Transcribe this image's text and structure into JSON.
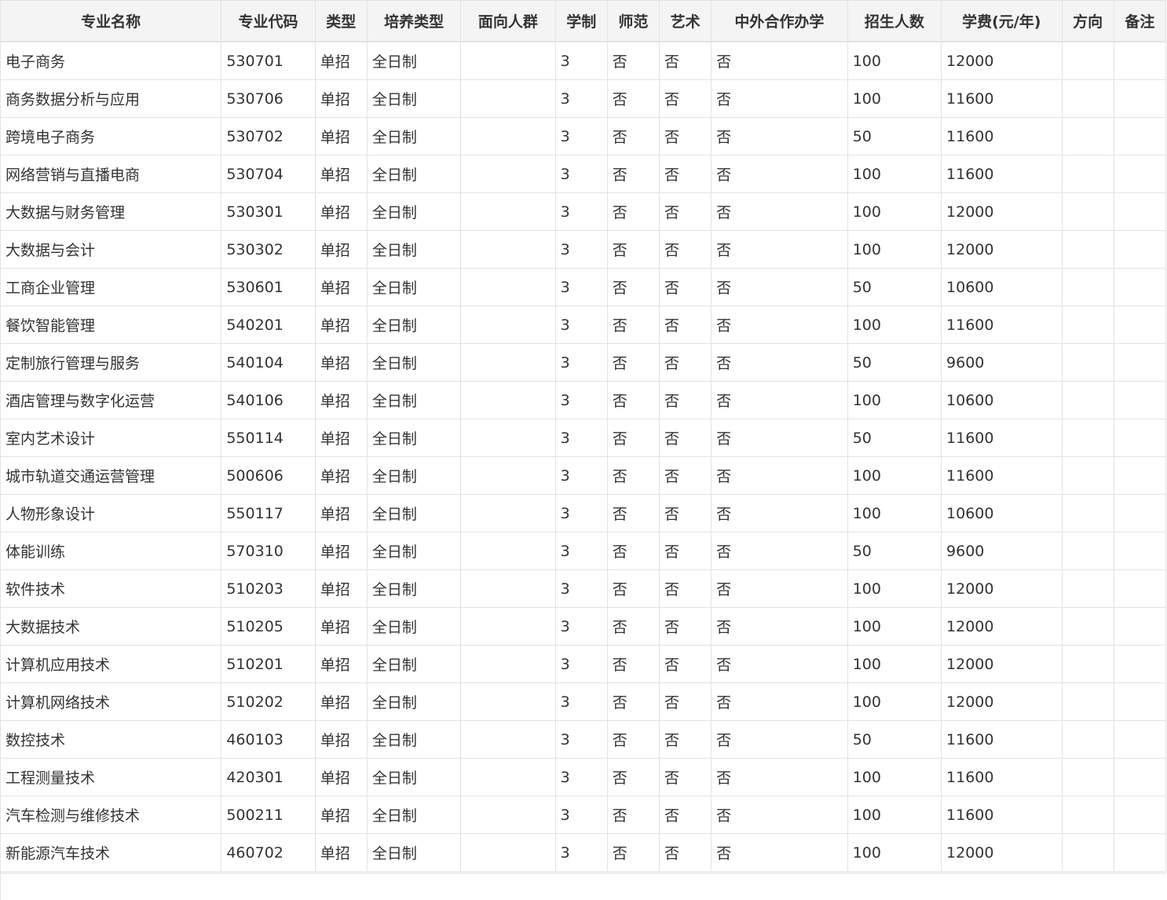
{
  "table": {
    "columns": [
      "专业名称",
      "专业代码",
      "类型",
      "培养类型",
      "面向人群",
      "学制",
      "师范",
      "艺术",
      "中外合作办学",
      "招生人数",
      "学费(元/年)",
      "方向",
      "备注"
    ],
    "rows": [
      [
        "电子商务",
        "530701",
        "单招",
        "全日制",
        "",
        "3",
        "否",
        "否",
        "否",
        "100",
        "12000",
        "",
        ""
      ],
      [
        "商务数据分析与应用",
        "530706",
        "单招",
        "全日制",
        "",
        "3",
        "否",
        "否",
        "否",
        "100",
        "11600",
        "",
        ""
      ],
      [
        "跨境电子商务",
        "530702",
        "单招",
        "全日制",
        "",
        "3",
        "否",
        "否",
        "否",
        "50",
        "11600",
        "",
        ""
      ],
      [
        "网络营销与直播电商",
        "530704",
        "单招",
        "全日制",
        "",
        "3",
        "否",
        "否",
        "否",
        "100",
        "11600",
        "",
        ""
      ],
      [
        "大数据与财务管理",
        "530301",
        "单招",
        "全日制",
        "",
        "3",
        "否",
        "否",
        "否",
        "100",
        "12000",
        "",
        ""
      ],
      [
        "大数据与会计",
        "530302",
        "单招",
        "全日制",
        "",
        "3",
        "否",
        "否",
        "否",
        "100",
        "12000",
        "",
        ""
      ],
      [
        "工商企业管理",
        "530601",
        "单招",
        "全日制",
        "",
        "3",
        "否",
        "否",
        "否",
        "50",
        "10600",
        "",
        ""
      ],
      [
        "餐饮智能管理",
        "540201",
        "单招",
        "全日制",
        "",
        "3",
        "否",
        "否",
        "否",
        "100",
        "11600",
        "",
        ""
      ],
      [
        "定制旅行管理与服务",
        "540104",
        "单招",
        "全日制",
        "",
        "3",
        "否",
        "否",
        "否",
        "50",
        "9600",
        "",
        ""
      ],
      [
        "酒店管理与数字化运营",
        "540106",
        "单招",
        "全日制",
        "",
        "3",
        "否",
        "否",
        "否",
        "100",
        "10600",
        "",
        ""
      ],
      [
        "室内艺术设计",
        "550114",
        "单招",
        "全日制",
        "",
        "3",
        "否",
        "否",
        "否",
        "50",
        "11600",
        "",
        ""
      ],
      [
        "城市轨道交通运营管理",
        "500606",
        "单招",
        "全日制",
        "",
        "3",
        "否",
        "否",
        "否",
        "100",
        "11600",
        "",
        ""
      ],
      [
        "人物形象设计",
        "550117",
        "单招",
        "全日制",
        "",
        "3",
        "否",
        "否",
        "否",
        "100",
        "10600",
        "",
        ""
      ],
      [
        "体能训练",
        "570310",
        "单招",
        "全日制",
        "",
        "3",
        "否",
        "否",
        "否",
        "50",
        "9600",
        "",
        ""
      ],
      [
        "软件技术",
        "510203",
        "单招",
        "全日制",
        "",
        "3",
        "否",
        "否",
        "否",
        "100",
        "12000",
        "",
        ""
      ],
      [
        "大数据技术",
        "510205",
        "单招",
        "全日制",
        "",
        "3",
        "否",
        "否",
        "否",
        "100",
        "12000",
        "",
        ""
      ],
      [
        "计算机应用技术",
        "510201",
        "单招",
        "全日制",
        "",
        "3",
        "否",
        "否",
        "否",
        "100",
        "12000",
        "",
        ""
      ],
      [
        "计算机网络技术",
        "510202",
        "单招",
        "全日制",
        "",
        "3",
        "否",
        "否",
        "否",
        "100",
        "12000",
        "",
        ""
      ],
      [
        "数控技术",
        "460103",
        "单招",
        "全日制",
        "",
        "3",
        "否",
        "否",
        "否",
        "50",
        "11600",
        "",
        ""
      ],
      [
        "工程测量技术",
        "420301",
        "单招",
        "全日制",
        "",
        "3",
        "否",
        "否",
        "否",
        "100",
        "11600",
        "",
        ""
      ],
      [
        "汽车检测与维修技术",
        "500211",
        "单招",
        "全日制",
        "",
        "3",
        "否",
        "否",
        "否",
        "100",
        "11600",
        "",
        ""
      ],
      [
        "新能源汽车技术",
        "460702",
        "单招",
        "全日制",
        "",
        "3",
        "否",
        "否",
        "否",
        "100",
        "12000",
        "",
        ""
      ]
    ]
  },
  "colors": {
    "header_bg": "#f4f4f4",
    "border": "#e3e3e3",
    "text": "#333333"
  }
}
